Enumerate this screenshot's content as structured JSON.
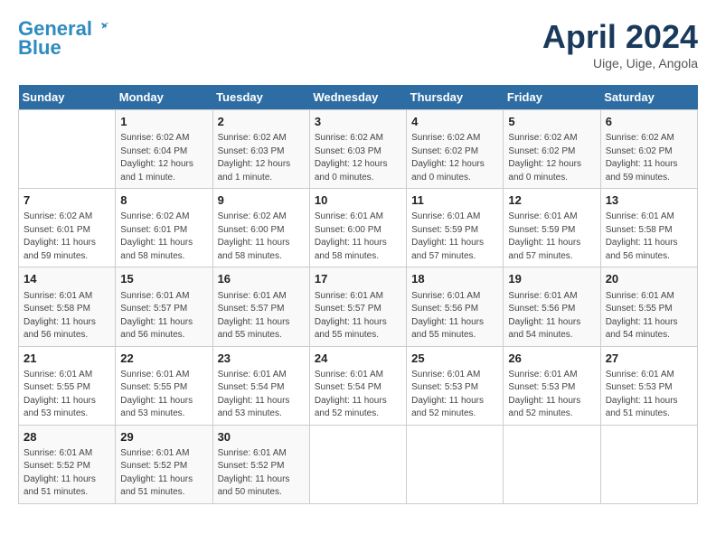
{
  "header": {
    "logo_line1": "General",
    "logo_line2": "Blue",
    "month_title": "April 2024",
    "location": "Uige, Uige, Angola"
  },
  "weekdays": [
    "Sunday",
    "Monday",
    "Tuesday",
    "Wednesday",
    "Thursday",
    "Friday",
    "Saturday"
  ],
  "weeks": [
    [
      {
        "day": "",
        "sunrise": "",
        "sunset": "",
        "daylight": ""
      },
      {
        "day": "1",
        "sunrise": "6:02 AM",
        "sunset": "6:04 PM",
        "daylight": "12 hours and 1 minute."
      },
      {
        "day": "2",
        "sunrise": "6:02 AM",
        "sunset": "6:03 PM",
        "daylight": "12 hours and 1 minute."
      },
      {
        "day": "3",
        "sunrise": "6:02 AM",
        "sunset": "6:03 PM",
        "daylight": "12 hours and 0 minutes."
      },
      {
        "day": "4",
        "sunrise": "6:02 AM",
        "sunset": "6:02 PM",
        "daylight": "12 hours and 0 minutes."
      },
      {
        "day": "5",
        "sunrise": "6:02 AM",
        "sunset": "6:02 PM",
        "daylight": "12 hours and 0 minutes."
      },
      {
        "day": "6",
        "sunrise": "6:02 AM",
        "sunset": "6:02 PM",
        "daylight": "11 hours and 59 minutes."
      }
    ],
    [
      {
        "day": "7",
        "sunrise": "6:02 AM",
        "sunset": "6:01 PM",
        "daylight": "11 hours and 59 minutes."
      },
      {
        "day": "8",
        "sunrise": "6:02 AM",
        "sunset": "6:01 PM",
        "daylight": "11 hours and 58 minutes."
      },
      {
        "day": "9",
        "sunrise": "6:02 AM",
        "sunset": "6:00 PM",
        "daylight": "11 hours and 58 minutes."
      },
      {
        "day": "10",
        "sunrise": "6:01 AM",
        "sunset": "6:00 PM",
        "daylight": "11 hours and 58 minutes."
      },
      {
        "day": "11",
        "sunrise": "6:01 AM",
        "sunset": "5:59 PM",
        "daylight": "11 hours and 57 minutes."
      },
      {
        "day": "12",
        "sunrise": "6:01 AM",
        "sunset": "5:59 PM",
        "daylight": "11 hours and 57 minutes."
      },
      {
        "day": "13",
        "sunrise": "6:01 AM",
        "sunset": "5:58 PM",
        "daylight": "11 hours and 56 minutes."
      }
    ],
    [
      {
        "day": "14",
        "sunrise": "6:01 AM",
        "sunset": "5:58 PM",
        "daylight": "11 hours and 56 minutes."
      },
      {
        "day": "15",
        "sunrise": "6:01 AM",
        "sunset": "5:57 PM",
        "daylight": "11 hours and 56 minutes."
      },
      {
        "day": "16",
        "sunrise": "6:01 AM",
        "sunset": "5:57 PM",
        "daylight": "11 hours and 55 minutes."
      },
      {
        "day": "17",
        "sunrise": "6:01 AM",
        "sunset": "5:57 PM",
        "daylight": "11 hours and 55 minutes."
      },
      {
        "day": "18",
        "sunrise": "6:01 AM",
        "sunset": "5:56 PM",
        "daylight": "11 hours and 55 minutes."
      },
      {
        "day": "19",
        "sunrise": "6:01 AM",
        "sunset": "5:56 PM",
        "daylight": "11 hours and 54 minutes."
      },
      {
        "day": "20",
        "sunrise": "6:01 AM",
        "sunset": "5:55 PM",
        "daylight": "11 hours and 54 minutes."
      }
    ],
    [
      {
        "day": "21",
        "sunrise": "6:01 AM",
        "sunset": "5:55 PM",
        "daylight": "11 hours and 53 minutes."
      },
      {
        "day": "22",
        "sunrise": "6:01 AM",
        "sunset": "5:55 PM",
        "daylight": "11 hours and 53 minutes."
      },
      {
        "day": "23",
        "sunrise": "6:01 AM",
        "sunset": "5:54 PM",
        "daylight": "11 hours and 53 minutes."
      },
      {
        "day": "24",
        "sunrise": "6:01 AM",
        "sunset": "5:54 PM",
        "daylight": "11 hours and 52 minutes."
      },
      {
        "day": "25",
        "sunrise": "6:01 AM",
        "sunset": "5:53 PM",
        "daylight": "11 hours and 52 minutes."
      },
      {
        "day": "26",
        "sunrise": "6:01 AM",
        "sunset": "5:53 PM",
        "daylight": "11 hours and 52 minutes."
      },
      {
        "day": "27",
        "sunrise": "6:01 AM",
        "sunset": "5:53 PM",
        "daylight": "11 hours and 51 minutes."
      }
    ],
    [
      {
        "day": "28",
        "sunrise": "6:01 AM",
        "sunset": "5:52 PM",
        "daylight": "11 hours and 51 minutes."
      },
      {
        "day": "29",
        "sunrise": "6:01 AM",
        "sunset": "5:52 PM",
        "daylight": "11 hours and 51 minutes."
      },
      {
        "day": "30",
        "sunrise": "6:01 AM",
        "sunset": "5:52 PM",
        "daylight": "11 hours and 50 minutes."
      },
      {
        "day": "",
        "sunrise": "",
        "sunset": "",
        "daylight": ""
      },
      {
        "day": "",
        "sunrise": "",
        "sunset": "",
        "daylight": ""
      },
      {
        "day": "",
        "sunrise": "",
        "sunset": "",
        "daylight": ""
      },
      {
        "day": "",
        "sunrise": "",
        "sunset": "",
        "daylight": ""
      }
    ]
  ],
  "labels": {
    "sunrise": "Sunrise:",
    "sunset": "Sunset:",
    "daylight": "Daylight:"
  }
}
